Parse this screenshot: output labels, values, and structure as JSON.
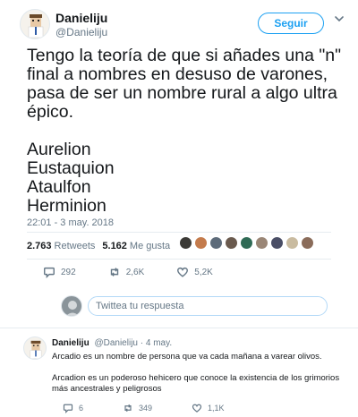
{
  "main_tweet": {
    "author_name": "Danieliju",
    "author_handle": "@Danieliju",
    "follow_label": "Seguir",
    "text": "Tengo la teoría de que si añades una \"n\" final a nombres en desuso de varones, pasa de ser un nombre rural a algo ultra épico.\n\nAurelion\nEustaquion\nAtaulfon\nHerminion",
    "timestamp": "22:01 - 3 may. 2018",
    "retweets_count": "2.763",
    "retweets_label": "Retweets",
    "likes_count": "5.162",
    "likes_label": "Me gusta",
    "liker_colors": [
      "#3b3a36",
      "#c47b4c",
      "#5d6b7a",
      "#6a5a4e",
      "#2f6a55",
      "#9a8676",
      "#4a4e66",
      "#c9bba0",
      "#8a6c5a"
    ],
    "actions": {
      "replies": "292",
      "retweets": "2,6K",
      "likes": "5,2K"
    },
    "reply_placeholder": "Twittea tu respuesta"
  },
  "reply_tweet": {
    "author_name": "Danieliju",
    "author_handle": "@Danieliju",
    "time": "· 4 may.",
    "line1": "Arcadio es un nombre de persona que va cada mañana a varear olivos.",
    "line2": "Arcadion es un poderoso hehicero que conoce la existencia de los grimorios",
    "line3": "más ancestrales y peligrosos",
    "actions": {
      "replies": "6",
      "retweets": "349",
      "likes": "1,1K"
    }
  },
  "colors": {
    "accent": "#1da1f2",
    "like": "#e0245e",
    "secondary_text": "#657786"
  }
}
